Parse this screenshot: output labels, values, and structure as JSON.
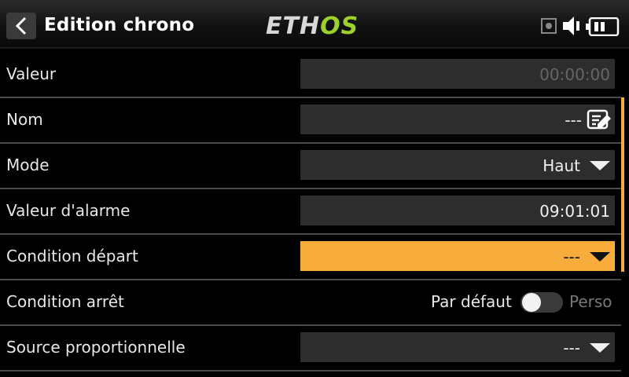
{
  "header": {
    "title": "Edition chrono",
    "logo_white": "ETH",
    "logo_green": "OS",
    "icons": [
      "back-arrow",
      "record",
      "speaker",
      "battery"
    ]
  },
  "rows": [
    {
      "label": "Valeur",
      "value": "00:00:00",
      "kind": "readonly"
    },
    {
      "label": "Nom",
      "value": "---",
      "kind": "text-edit"
    },
    {
      "label": "Mode",
      "value": "Haut",
      "kind": "dropdown"
    },
    {
      "label": "Valeur d'alarme",
      "value": "09:01:01",
      "kind": "time"
    },
    {
      "label": "Condition départ",
      "value": "---",
      "kind": "dropdown",
      "selected": true
    },
    {
      "label": "Condition arrêt",
      "toggle_off": "Par défaut",
      "toggle_on": "Perso",
      "toggle_state": "off",
      "kind": "toggle"
    },
    {
      "label": "Source proportionnelle",
      "value": "---",
      "kind": "dropdown"
    }
  ],
  "colors": {
    "accent": "#f7ac3c",
    "logo_green": "#9bd32a",
    "field_bg": "#2d2d2d"
  }
}
